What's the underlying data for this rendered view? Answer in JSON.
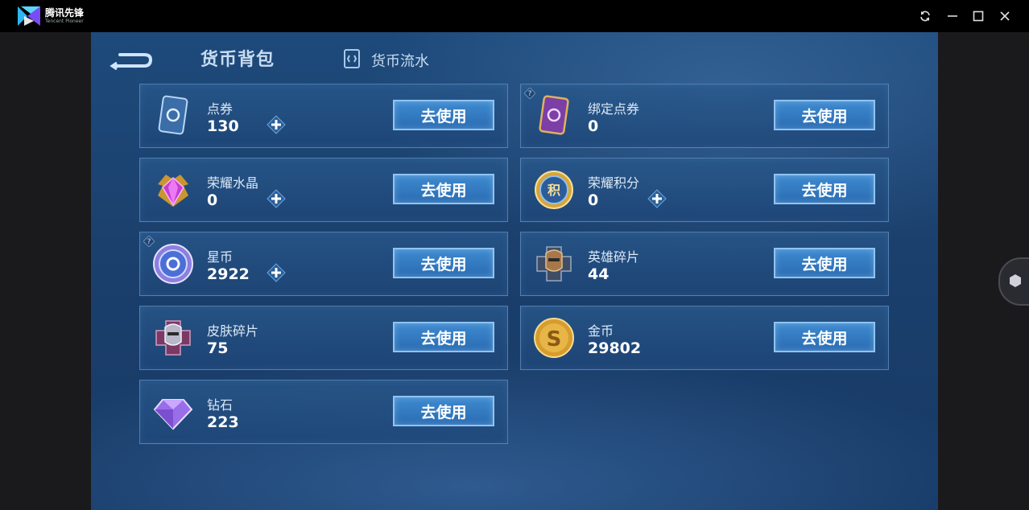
{
  "window": {
    "app_name": "腾讯先锋",
    "app_name_sub": "Tencent Pioneer"
  },
  "header": {
    "tab_active": "货币背包",
    "tab_flow": "货币流水"
  },
  "use_label": "去使用",
  "cards": [
    {
      "name": "点券",
      "value": "130"
    },
    {
      "name": "绑定点券",
      "value": "0"
    },
    {
      "name": "荣耀水晶",
      "value": "0"
    },
    {
      "name": "荣耀积分",
      "value": "0"
    },
    {
      "name": "星币",
      "value": "2922"
    },
    {
      "name": "英雄碎片",
      "value": "44"
    },
    {
      "name": "皮肤碎片",
      "value": "75"
    },
    {
      "name": "金币",
      "value": "29802"
    },
    {
      "name": "钻石",
      "value": "223"
    }
  ],
  "icons": {
    "app_logo": "tencent-pioneer-logo",
    "refresh": "refresh-icon",
    "minimize": "minimize-icon",
    "maximize": "maximize-icon",
    "close": "close-icon",
    "back": "back-arrow-icon",
    "flow": "currency-flow-icon"
  },
  "colors": {
    "accent": "#2a6cb2",
    "button_border": "#8ec4f3",
    "background": "#1b3f6c"
  }
}
